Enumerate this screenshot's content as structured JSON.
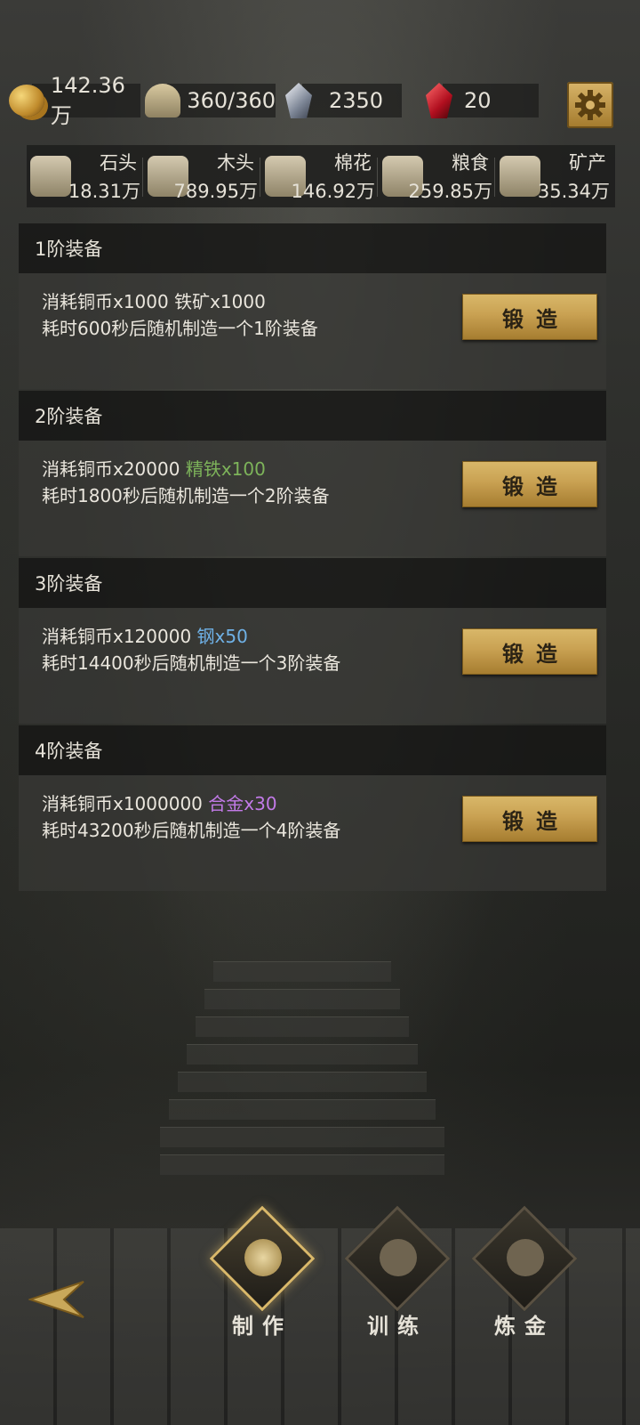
{
  "resources": {
    "copper": {
      "value": "142.36万",
      "icon": "coin-stack-icon"
    },
    "population": {
      "value": "360/360",
      "icon": "people-icon"
    },
    "crystal": {
      "value": "2350",
      "icon": "crystal-icon"
    },
    "ruby": {
      "value": "20",
      "icon": "ruby-icon"
    },
    "settings_icon": "gear-icon"
  },
  "materials": [
    {
      "name": "石头",
      "value": "18.31万",
      "icon": "stone-icon"
    },
    {
      "name": "木头",
      "value": "789.95万",
      "icon": "wood-icon"
    },
    {
      "name": "棉花",
      "value": "146.92万",
      "icon": "cotton-icon"
    },
    {
      "name": "粮食",
      "value": "259.85万",
      "icon": "grain-icon"
    },
    {
      "name": "矿产",
      "value": "35.34万",
      "icon": "ore-icon"
    }
  ],
  "crafts": [
    {
      "title": "1阶装备",
      "cost": "消耗铜币x1000 ",
      "material": "铁矿x1000",
      "material_color": "#eae6dd",
      "desc": "耗时600秒后随机制造一个1阶装备",
      "button": "锻造"
    },
    {
      "title": "2阶装备",
      "cost": "消耗铜币x20000 ",
      "material": "精铁x100",
      "material_color": "#7db35a",
      "desc": "耗时1800秒后随机制造一个2阶装备",
      "button": "锻造"
    },
    {
      "title": "3阶装备",
      "cost": "消耗铜币x120000 ",
      "material": "钢x50",
      "material_color": "#6fb1e6",
      "desc": "耗时14400秒后随机制造一个3阶装备",
      "button": "锻造"
    },
    {
      "title": "4阶装备",
      "cost": "消耗铜币x1000000 ",
      "material": "合金x30",
      "material_color": "#c27ae8",
      "desc": "耗时43200秒后随机制造一个4阶装备",
      "button": "锻造"
    }
  ],
  "nav": {
    "back_icon": "back-arrow-icon",
    "tabs": [
      {
        "label": "制作",
        "icon": "craft-icon",
        "active": true
      },
      {
        "label": "训练",
        "icon": "train-icon",
        "active": false
      },
      {
        "label": "炼金",
        "icon": "alchemy-icon",
        "active": false
      }
    ]
  }
}
